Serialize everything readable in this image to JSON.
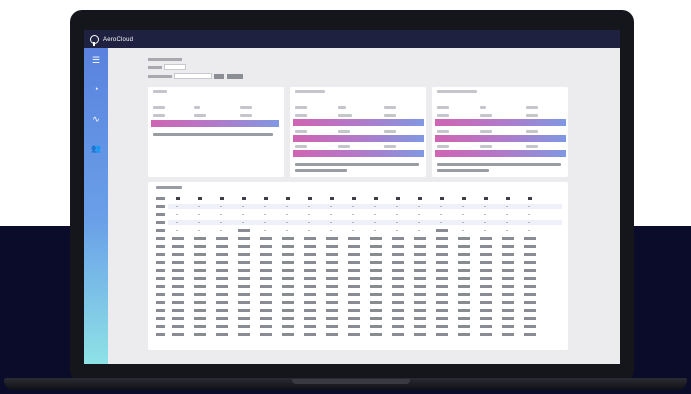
{
  "app": {
    "brand_name": "AeroCloud"
  },
  "sidebar": {
    "items": [
      {
        "name": "menu",
        "glyph": "☰"
      },
      {
        "name": "dashboard",
        "glyph": "◔"
      },
      {
        "name": "trends",
        "glyph": "∿"
      },
      {
        "name": "users",
        "glyph": "👥"
      }
    ]
  },
  "colors": {
    "topbar": "#1e2140",
    "sidebar_top": "#5a82de",
    "sidebar_bottom": "#8ee2e6",
    "highlight_start": "#d064b4",
    "highlight_end": "#8098e2",
    "backdrop": "#0a0c2a"
  }
}
